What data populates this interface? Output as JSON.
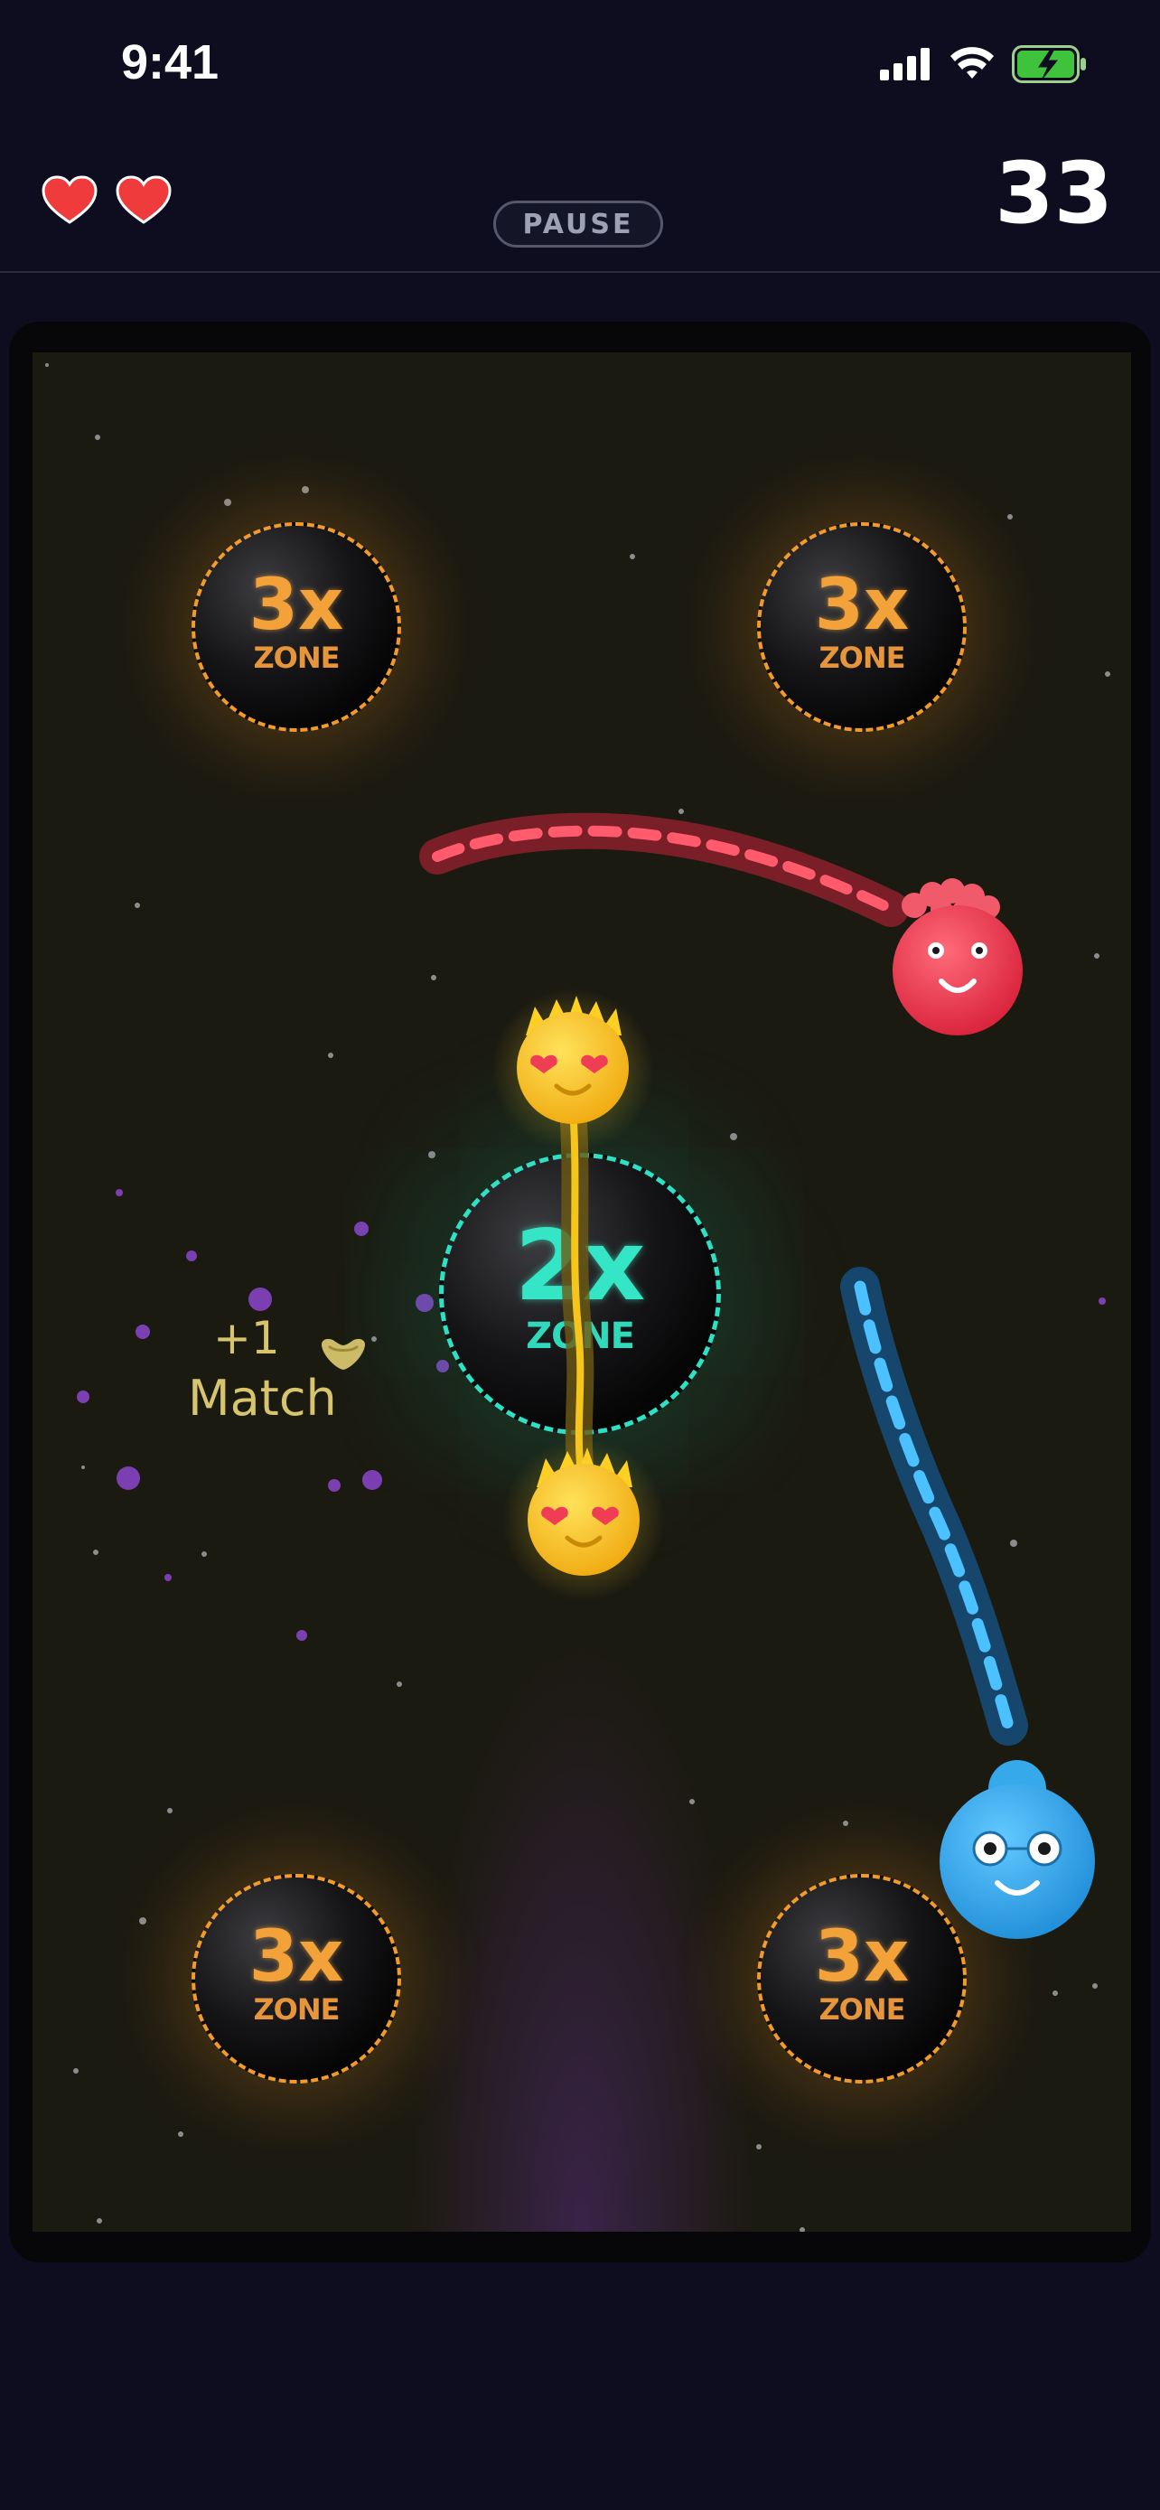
{
  "status_bar": {
    "time": "9:41"
  },
  "hud": {
    "lives_count": 2,
    "pause_label": "PAUSE",
    "score": "33"
  },
  "zones": [
    {
      "id": "top-left",
      "multiplier": "3x",
      "label": "ZONE"
    },
    {
      "id": "top-right",
      "multiplier": "3x",
      "label": "ZONE"
    },
    {
      "id": "center",
      "multiplier": "2x",
      "label": "ZONE"
    },
    {
      "id": "bottom-left",
      "multiplier": "3x",
      "label": "ZONE"
    },
    {
      "id": "bottom-right",
      "multiplier": "3x",
      "label": "ZONE"
    }
  ],
  "match_popup": {
    "plus": "+1",
    "word": "Match"
  },
  "colors": {
    "zone3": "#f39a2d",
    "zone2": "#2ee0c4",
    "red_creature": "#e8344a",
    "blue_creature": "#2ba6ea",
    "yellow_creature": "#f6c51c",
    "heart": "#ef3b3b"
  },
  "icons": [
    "heart-icon",
    "signal-icon",
    "wifi-icon",
    "battery-icon",
    "creature-red",
    "creature-blue",
    "creature-yellow"
  ]
}
